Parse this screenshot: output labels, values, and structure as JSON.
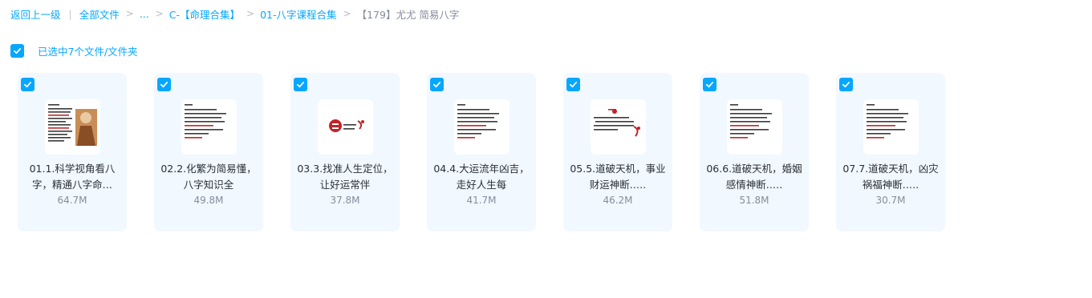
{
  "breadcrumb": {
    "back": "返回上一级",
    "root": "全部文件",
    "ellipsis": "...",
    "level1": "C-【命理合集】",
    "level2": "01-八字课程合集",
    "current": "【179】尤尤 简易八字",
    "separator": ">",
    "pipe": "|"
  },
  "selection": {
    "text": "已选中7个文件/文件夹",
    "checked": true
  },
  "colors": {
    "accent": "#06a7ff",
    "card_bg": "#f1f8ff",
    "text_secondary": "#878c9c",
    "thumb_red": "#c0242a"
  },
  "files": [
    {
      "name": "01.1.科学视角看八字，精通八字命…",
      "size": "64.7M",
      "thumb": "doc-portrait-thumb"
    },
    {
      "name": "02.2.化繁为简易懂，八字知识全",
      "size": "49.8M",
      "thumb": "doc-text-thumb"
    },
    {
      "name": "03.3.找准人生定位，让好运常伴",
      "size": "37.8M",
      "thumb": "logo-seal-thumb"
    },
    {
      "name": "04.4.大运流年凶吉，走好人生每",
      "size": "41.7M",
      "thumb": "doc-text-thumb"
    },
    {
      "name": "05.5.道破天机，事业财运神断.….",
      "size": "46.2M",
      "thumb": "doc-seal-thumb"
    },
    {
      "name": "06.6.道破天机，婚姻感情神断.….",
      "size": "51.8M",
      "thumb": "doc-text-thumb"
    },
    {
      "name": "07.7.道破天机，凶灾祸福神断.….",
      "size": "30.7M",
      "thumb": "doc-text-thumb"
    }
  ]
}
